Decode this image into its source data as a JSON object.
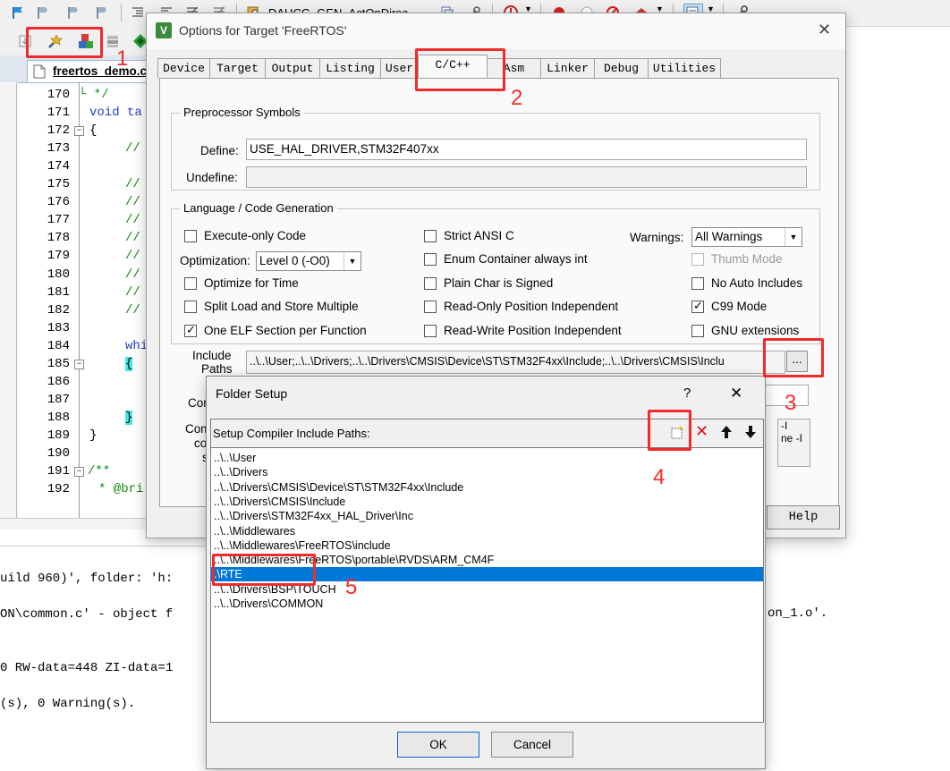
{
  "editor": {
    "tab_name": "freertos_demo.c",
    "toolbar_dropdown": "DAUCG_GEN_ActOnDirec",
    "line_numbers": [
      "170",
      "171",
      "172",
      "173",
      "174",
      "175",
      "176",
      "177",
      "178",
      "179",
      "180",
      "181",
      "182",
      "183",
      "184",
      "185",
      "186",
      "187",
      "188",
      "189",
      "190",
      "191",
      "192"
    ],
    "code_lines": [
      "└ */",
      "void ta",
      "{",
      "//",
      "",
      "//",
      "//",
      "//",
      "//",
      "//",
      "//",
      "//",
      "//",
      "",
      "whi",
      "{",
      "",
      "",
      "}",
      "}",
      "",
      "/**",
      "* @bri"
    ]
  },
  "build_output": {
    "lines": [
      "uild 960)', folder: 'h:",
      "ON\\common.c' - object f",
      "",
      "0 RW-data=448 ZI-data=1",
      "",
      "(s), 0 Warning(s)."
    ],
    "right_fragments": [
      "on_1.o'."
    ]
  },
  "options_dialog": {
    "title": "Options for Target 'FreeRTOS'",
    "tabs": [
      "Device",
      "Target",
      "Output",
      "Listing",
      "User",
      "C/C++",
      "Asm",
      "Linker",
      "Debug",
      "Utilities"
    ],
    "active_tab": "C/C++",
    "preprocessor": {
      "group_label": "Preprocessor Symbols",
      "define_label": "Define:",
      "define_value": "USE_HAL_DRIVER,STM32F407xx",
      "undefine_label": "Undefine:",
      "undefine_value": ""
    },
    "language": {
      "group_label": "Language / Code Generation",
      "execute_only": "Execute-only Code",
      "optimization_label": "Optimization:",
      "optimization_value": "Level 0 (-O0)",
      "optimize_time": "Optimize for Time",
      "split_load": "Split Load and Store Multiple",
      "one_elf": "One ELF Section per Function",
      "strict_ansi": "Strict ANSI C",
      "enum_container": "Enum Container always int",
      "plain_char": "Plain Char is Signed",
      "ropi": "Read-Only Position Independent",
      "rwpi": "Read-Write Position Independent",
      "warnings_label": "Warnings:",
      "warnings_value": "All Warnings",
      "thumb_mode": "Thumb Mode",
      "no_auto_includes": "No Auto Includes",
      "c99_mode": "C99 Mode",
      "gnu_ext": "GNU extensions"
    },
    "include_paths": {
      "label_line1": "Include",
      "label_line2": "Paths",
      "value": "..\\..\\User;..\\..\\Drivers;..\\..\\Drivers\\CMSIS\\Device\\ST\\STM32F4xx\\Include;..\\..\\Drivers\\CMSIS\\Inclu",
      "browse_label": "..."
    },
    "misc_label_fragment": "Cor",
    "compiler_label_fragments": [
      "Com",
      "co",
      "s"
    ],
    "compiler_right_fragments": [
      "-I",
      "ne -I"
    ],
    "help_button": "Help"
  },
  "folder_setup": {
    "title": "Folder Setup",
    "help_glyph": "?",
    "close_glyph": "✕",
    "header_label": "Setup Compiler Include Paths:",
    "paths": [
      "..\\..\\User",
      "..\\..\\Drivers",
      "..\\..\\Drivers\\CMSIS\\Device\\ST\\STM32F4xx\\Include",
      "..\\..\\Drivers\\CMSIS\\Include",
      "..\\..\\Drivers\\STM32F4xx_HAL_Driver\\Inc",
      "..\\..\\Middlewares",
      "..\\..\\Middlewares\\FreeRTOS\\include",
      "..\\..\\Middlewares\\FreeRTOS\\portable\\RVDS\\ARM_CM4F",
      ".\\RTE",
      "..\\..\\Drivers\\BSP\\TOUCH",
      "..\\..\\Drivers\\COMMON"
    ],
    "selected_index": 8,
    "ok_label": "OK",
    "cancel_label": "Cancel"
  },
  "annotations": [
    "1",
    "2",
    "3",
    "4",
    "5"
  ],
  "colors": {
    "annotation_red": "#ef2b2b",
    "selection_blue": "#0078d7"
  }
}
